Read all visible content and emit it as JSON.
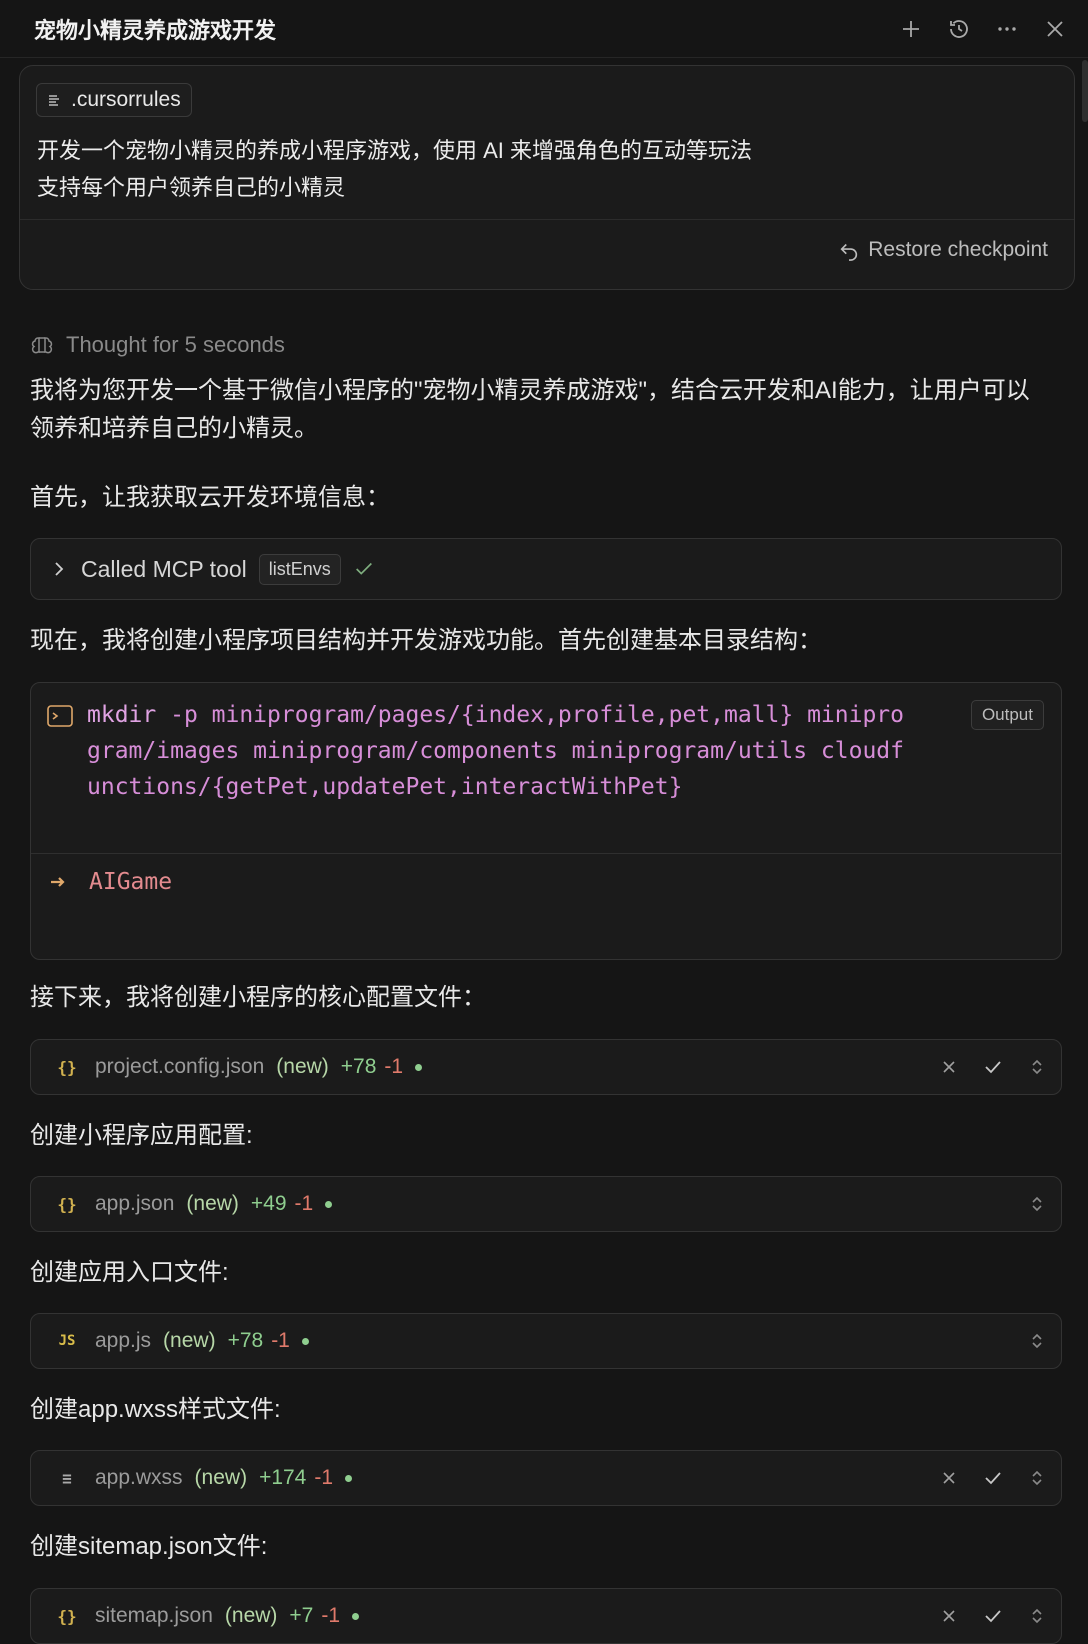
{
  "header": {
    "title": "宠物小精灵养成游戏开发",
    "icons": [
      "plus-icon",
      "history-icon",
      "more-icon",
      "close-icon"
    ]
  },
  "prompt": {
    "file_chip": ".cursorrules",
    "line1": "开发一个宠物小精灵的养成小程序游戏，使用 AI 来增强角色的互动等玩法",
    "line2": "支持每个用户领养自己的小精灵",
    "restore_label": "Restore checkpoint"
  },
  "thought": {
    "label": "Thought for 5 seconds"
  },
  "messages": {
    "intro": "我将为您开发一个基于微信小程序的\"宠物小精灵养成游戏\"，结合云开发和AI能力，让用户可以领养和培养自己的小精灵。",
    "env": "首先，让我获取云开发环境信息：",
    "create_structure": "现在，我将创建小程序项目结构并开发游戏功能。首先创建基本目录结构：",
    "core_config": "接下来，我将创建小程序的核心配置文件：",
    "app_config": "创建小程序应用配置:",
    "entry": "创建应用入口文件:",
    "wxss": "创建app.wxss样式文件:",
    "sitemap": "创建sitemap.json文件:"
  },
  "mcp": {
    "label": "Called MCP tool",
    "tool": "listEnvs"
  },
  "terminal": {
    "command_kw": "mkdir",
    "command_rest": " -p miniprogram/pages/{index,profile,pet,mall} miniprogram/images miniprogram/components miniprogram/utils cloudfunctions/{getPet,updatePet,interactWithPet}",
    "output_label": "Output",
    "output_dir": "AIGame"
  },
  "files": [
    {
      "icon": "{}",
      "name": "project.config.json",
      "status": "(new)",
      "added": "+78",
      "removed": "-1",
      "actions": true
    },
    {
      "icon": "{}",
      "name": "app.json",
      "status": "(new)",
      "added": "+49",
      "removed": "-1",
      "actions": false
    },
    {
      "icon": "JS",
      "name": "app.js",
      "status": "(new)",
      "added": "+78",
      "removed": "-1",
      "actions": false
    },
    {
      "icon": "≡",
      "name": "app.wxss",
      "status": "(new)",
      "added": "+174",
      "removed": "-1",
      "actions": true
    },
    {
      "icon": "{}",
      "name": "sitemap.json",
      "status": "(new)",
      "added": "+7",
      "removed": "-1",
      "actions": true
    }
  ],
  "colors": {
    "background": "#151515",
    "card": "#1b1b1b",
    "command": "#d78ed8",
    "added": "#8fce8f",
    "removed": "#e07a6b"
  }
}
